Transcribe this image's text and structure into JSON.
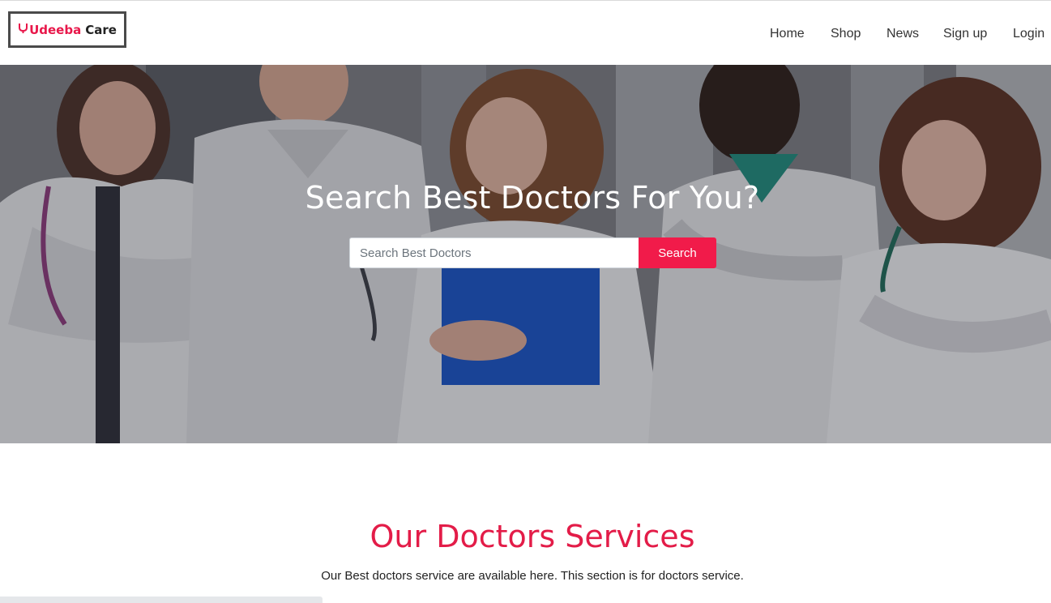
{
  "brand": {
    "icon": "stethoscope-icon",
    "name_part1": "Udeeba",
    "name_part2": "Care",
    "accent_color": "#e8174a"
  },
  "nav": {
    "items": [
      {
        "label": "Home"
      },
      {
        "label": "Shop"
      },
      {
        "label": "News"
      },
      {
        "label": "Sign up"
      },
      {
        "label": "Login"
      }
    ]
  },
  "hero": {
    "title": "Search Best Doctors For You?",
    "search": {
      "placeholder": "Search Best Doctors",
      "value": "",
      "button_label": "Search",
      "button_color": "#f11b4a"
    }
  },
  "services": {
    "title": "Our Doctors Services",
    "subtitle": "Our Best doctors service are available here. This section is for doctors service.",
    "title_color": "#e31c48"
  }
}
